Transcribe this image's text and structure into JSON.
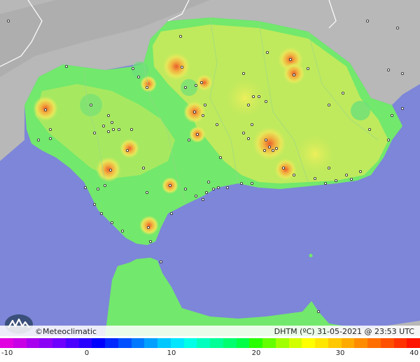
{
  "brand": "©Meteoclimatic",
  "legend_title": "DHTM (ºC)  31-05-2021 @ 23:53 UTC",
  "scale": {
    "ticks": [
      "-10",
      "0",
      "10",
      "20",
      "30",
      "40"
    ],
    "colors": [
      "#e000e0",
      "#c800e6",
      "#a800ee",
      "#8c00f6",
      "#6e00ff",
      "#4a00ff",
      "#2a00ff",
      "#0000ff",
      "#0028ff",
      "#0050ff",
      "#0078ff",
      "#00a0ff",
      "#00c8ff",
      "#00e6ff",
      "#00ffe6",
      "#00ffbe",
      "#00ff96",
      "#00ff6e",
      "#00ff46",
      "#28ff00",
      "#64ff00",
      "#a0ff00",
      "#d2ff00",
      "#ffff00",
      "#ffe600",
      "#ffc800",
      "#ffaa00",
      "#ff8c00",
      "#ff6e00",
      "#ff5000",
      "#ff3200",
      "#ff1400"
    ]
  },
  "colors": {
    "sea": "#7d86d8",
    "land_outside": "#b9b9b9",
    "land_main": "#72e86c",
    "land_warm": "#c8ea5c",
    "hot_spot": "#f2a63c"
  }
}
